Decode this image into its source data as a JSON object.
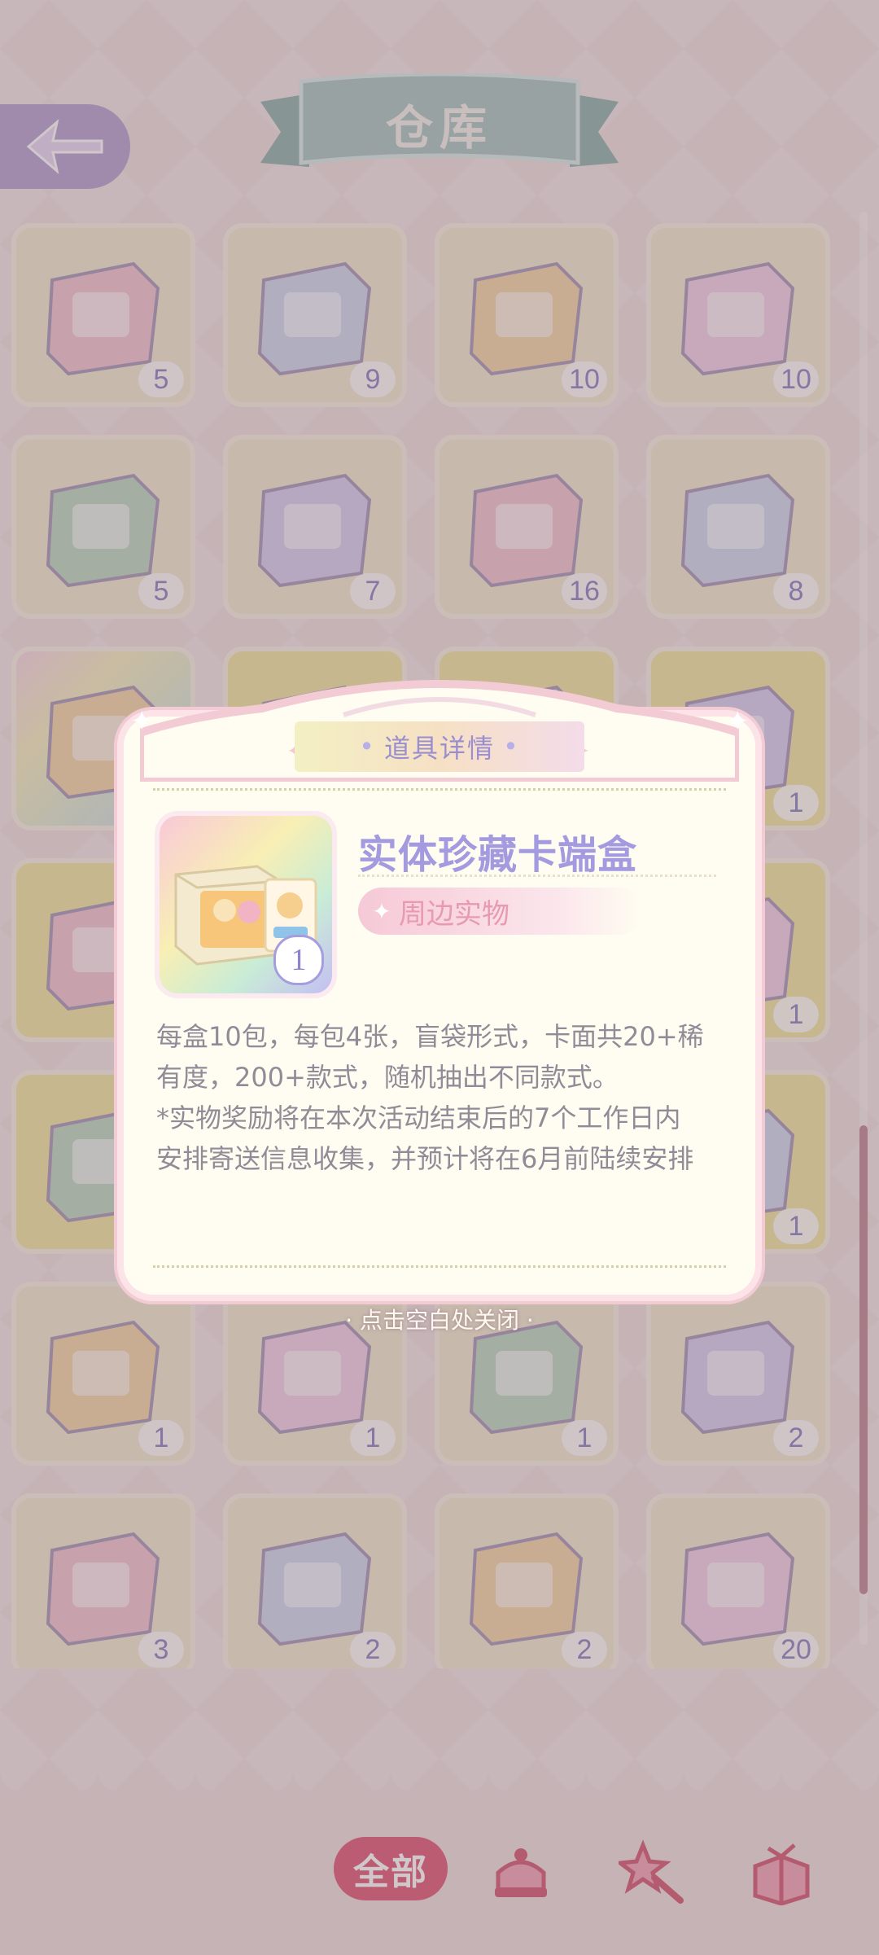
{
  "header": {
    "title": "仓库"
  },
  "grid": {
    "items": [
      {
        "name": "medical-card-icon",
        "count": "5",
        "style": "plain"
      },
      {
        "name": "acting-book-icon",
        "count": "9",
        "style": "plain"
      },
      {
        "name": "handcraft-book-icon",
        "count": "10",
        "style": "plain"
      },
      {
        "name": "art-book-icon",
        "count": "10",
        "style": "plain"
      },
      {
        "name": "puzzle-ticket-icon",
        "count": "5",
        "style": "plain"
      },
      {
        "name": "mirror-icon",
        "count": "7",
        "style": "plain"
      },
      {
        "name": "scissors-icon",
        "count": "16",
        "style": "plain"
      },
      {
        "name": "quill-ink-icon",
        "count": "8",
        "style": "plain"
      },
      {
        "name": "card-box-icon",
        "count": "",
        "style": "rainbow"
      },
      {
        "name": "item-icon",
        "count": "",
        "style": "gold"
      },
      {
        "name": "item-icon",
        "count": "",
        "style": "gold"
      },
      {
        "name": "grocery-bag-icon",
        "count": "1",
        "style": "gold"
      },
      {
        "name": "card-pack-icon",
        "count": "",
        "style": "gold"
      },
      {
        "name": "item-icon",
        "count": "",
        "style": "plain"
      },
      {
        "name": "item-icon",
        "count": "",
        "style": "plain"
      },
      {
        "name": "badge-icon",
        "count": "1",
        "style": "gold"
      },
      {
        "name": "candy-jar-icon",
        "count": "",
        "style": "gold"
      },
      {
        "name": "item-icon",
        "count": "",
        "style": "plain"
      },
      {
        "name": "item-icon",
        "count": "",
        "style": "plain"
      },
      {
        "name": "plate-icon",
        "count": "1",
        "style": "gold"
      },
      {
        "name": "dress-sketch-icon",
        "count": "1",
        "style": "plain"
      },
      {
        "name": "goblet-icon",
        "count": "1",
        "style": "plain"
      },
      {
        "name": "yarn-icon",
        "count": "1",
        "style": "plain"
      },
      {
        "name": "wreath-icon",
        "count": "2",
        "style": "plain"
      },
      {
        "name": "cape-stand-icon",
        "count": "3",
        "style": "plain"
      },
      {
        "name": "cocktail-glass-icon",
        "count": "2",
        "style": "plain"
      },
      {
        "name": "folded-cloth-icon",
        "count": "2",
        "style": "plain"
      },
      {
        "name": "shovel-icon",
        "count": "20",
        "style": "plain"
      }
    ]
  },
  "modal": {
    "title": "道具详情",
    "item_name": "实体珍藏卡端盒",
    "tag": "周边实物",
    "count": "1",
    "description": [
      "每盒10包，每包4张，盲袋形式，卡面共20+稀",
      "有度，200+款式，随机抽出不同款式。",
      "*实物奖励将在本次活动结束后的7个工作日内",
      "安排寄送信息收集，并预计将在6月前陆续安排"
    ],
    "close_hint": "· 点击空白处关闭 ·"
  },
  "bottom_nav": {
    "all_label": "全部",
    "icons": [
      "cake-icon",
      "magic-wand-icon",
      "gift-box-icon"
    ]
  },
  "colors": {
    "accent_pink": "#e15b78",
    "lavender": "#a39ae0",
    "tag_pink": "#e89ab2"
  }
}
